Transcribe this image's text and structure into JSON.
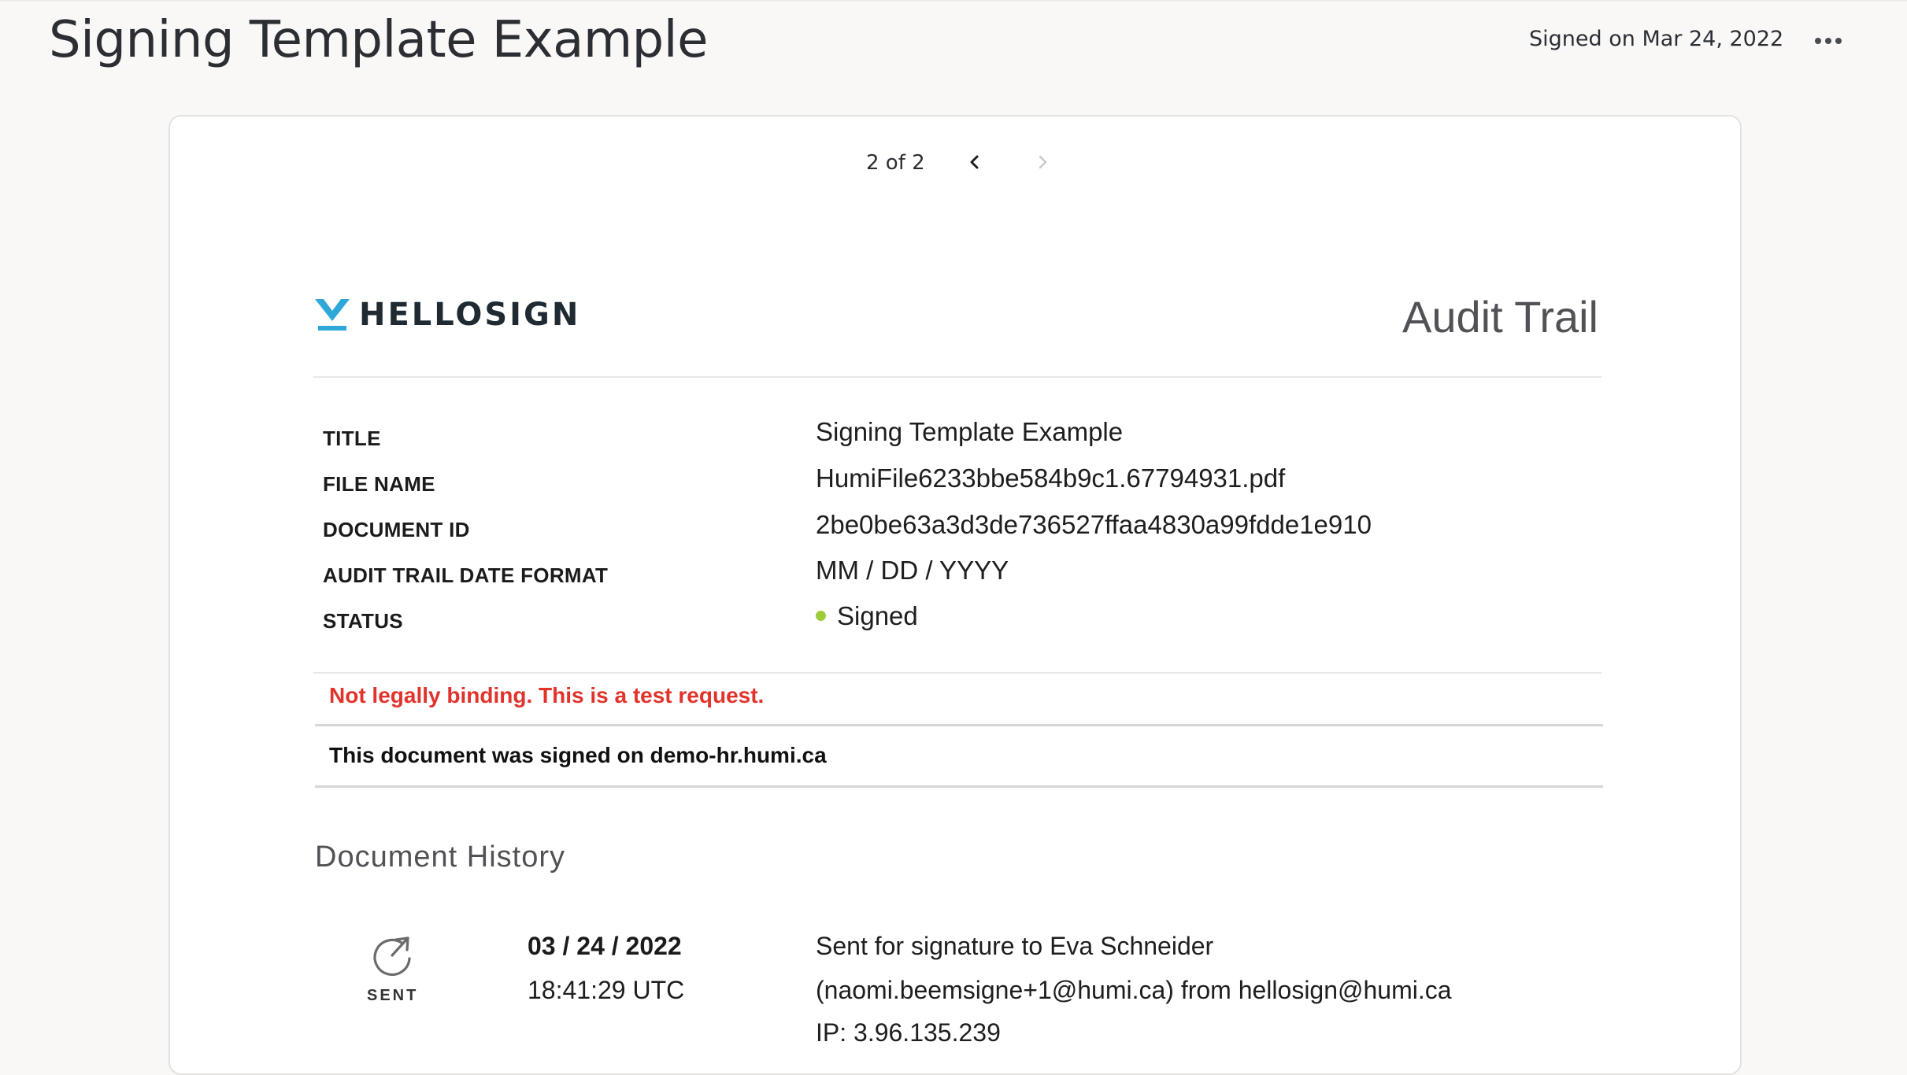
{
  "header": {
    "title": "Signing Template Example",
    "signed_status": "Signed on Mar 24, 2022",
    "more_icon": "more-horizontal-icon"
  },
  "viewer": {
    "pager_label": "2 of 2",
    "prev_icon": "chevron-left-icon",
    "next_icon": "chevron-right-icon",
    "next_disabled": true
  },
  "document": {
    "brand": "HELLOSIGN",
    "heading": "Audit Trail",
    "meta": [
      {
        "label": "TITLE",
        "value": "Signing Template Example"
      },
      {
        "label": "FILE NAME",
        "value": "HumiFile6233bbe584b9c1.67794931.pdf"
      },
      {
        "label": "DOCUMENT ID",
        "value": "2be0be63a3d3de736527ffaa4830a99fdde1e910"
      },
      {
        "label": "AUDIT TRAIL DATE FORMAT",
        "value": "MM / DD / YYYY"
      },
      {
        "label": "STATUS",
        "value": "Signed"
      }
    ],
    "warning": "Not legally binding. This is a test request.",
    "signed_on_text": "This document was signed on demo-hr.humi.ca",
    "history_title": "Document History",
    "history": [
      {
        "type": "SENT",
        "icon": "sent-arrow-icon",
        "date": "03 / 24 / 2022",
        "time": "18:41:29 UTC",
        "lines": [
          "Sent for signature to Eva Schneider",
          "(naomi.beemsigne+1@humi.ca) from hellosign@humi.ca",
          "IP: 3.96.135.239"
        ]
      }
    ]
  },
  "colors": {
    "warning": "#e1332b",
    "status_dot": "#9ccc3a",
    "brand_accent": "#2ea8d8",
    "page_bg": "#f9f8f7"
  }
}
